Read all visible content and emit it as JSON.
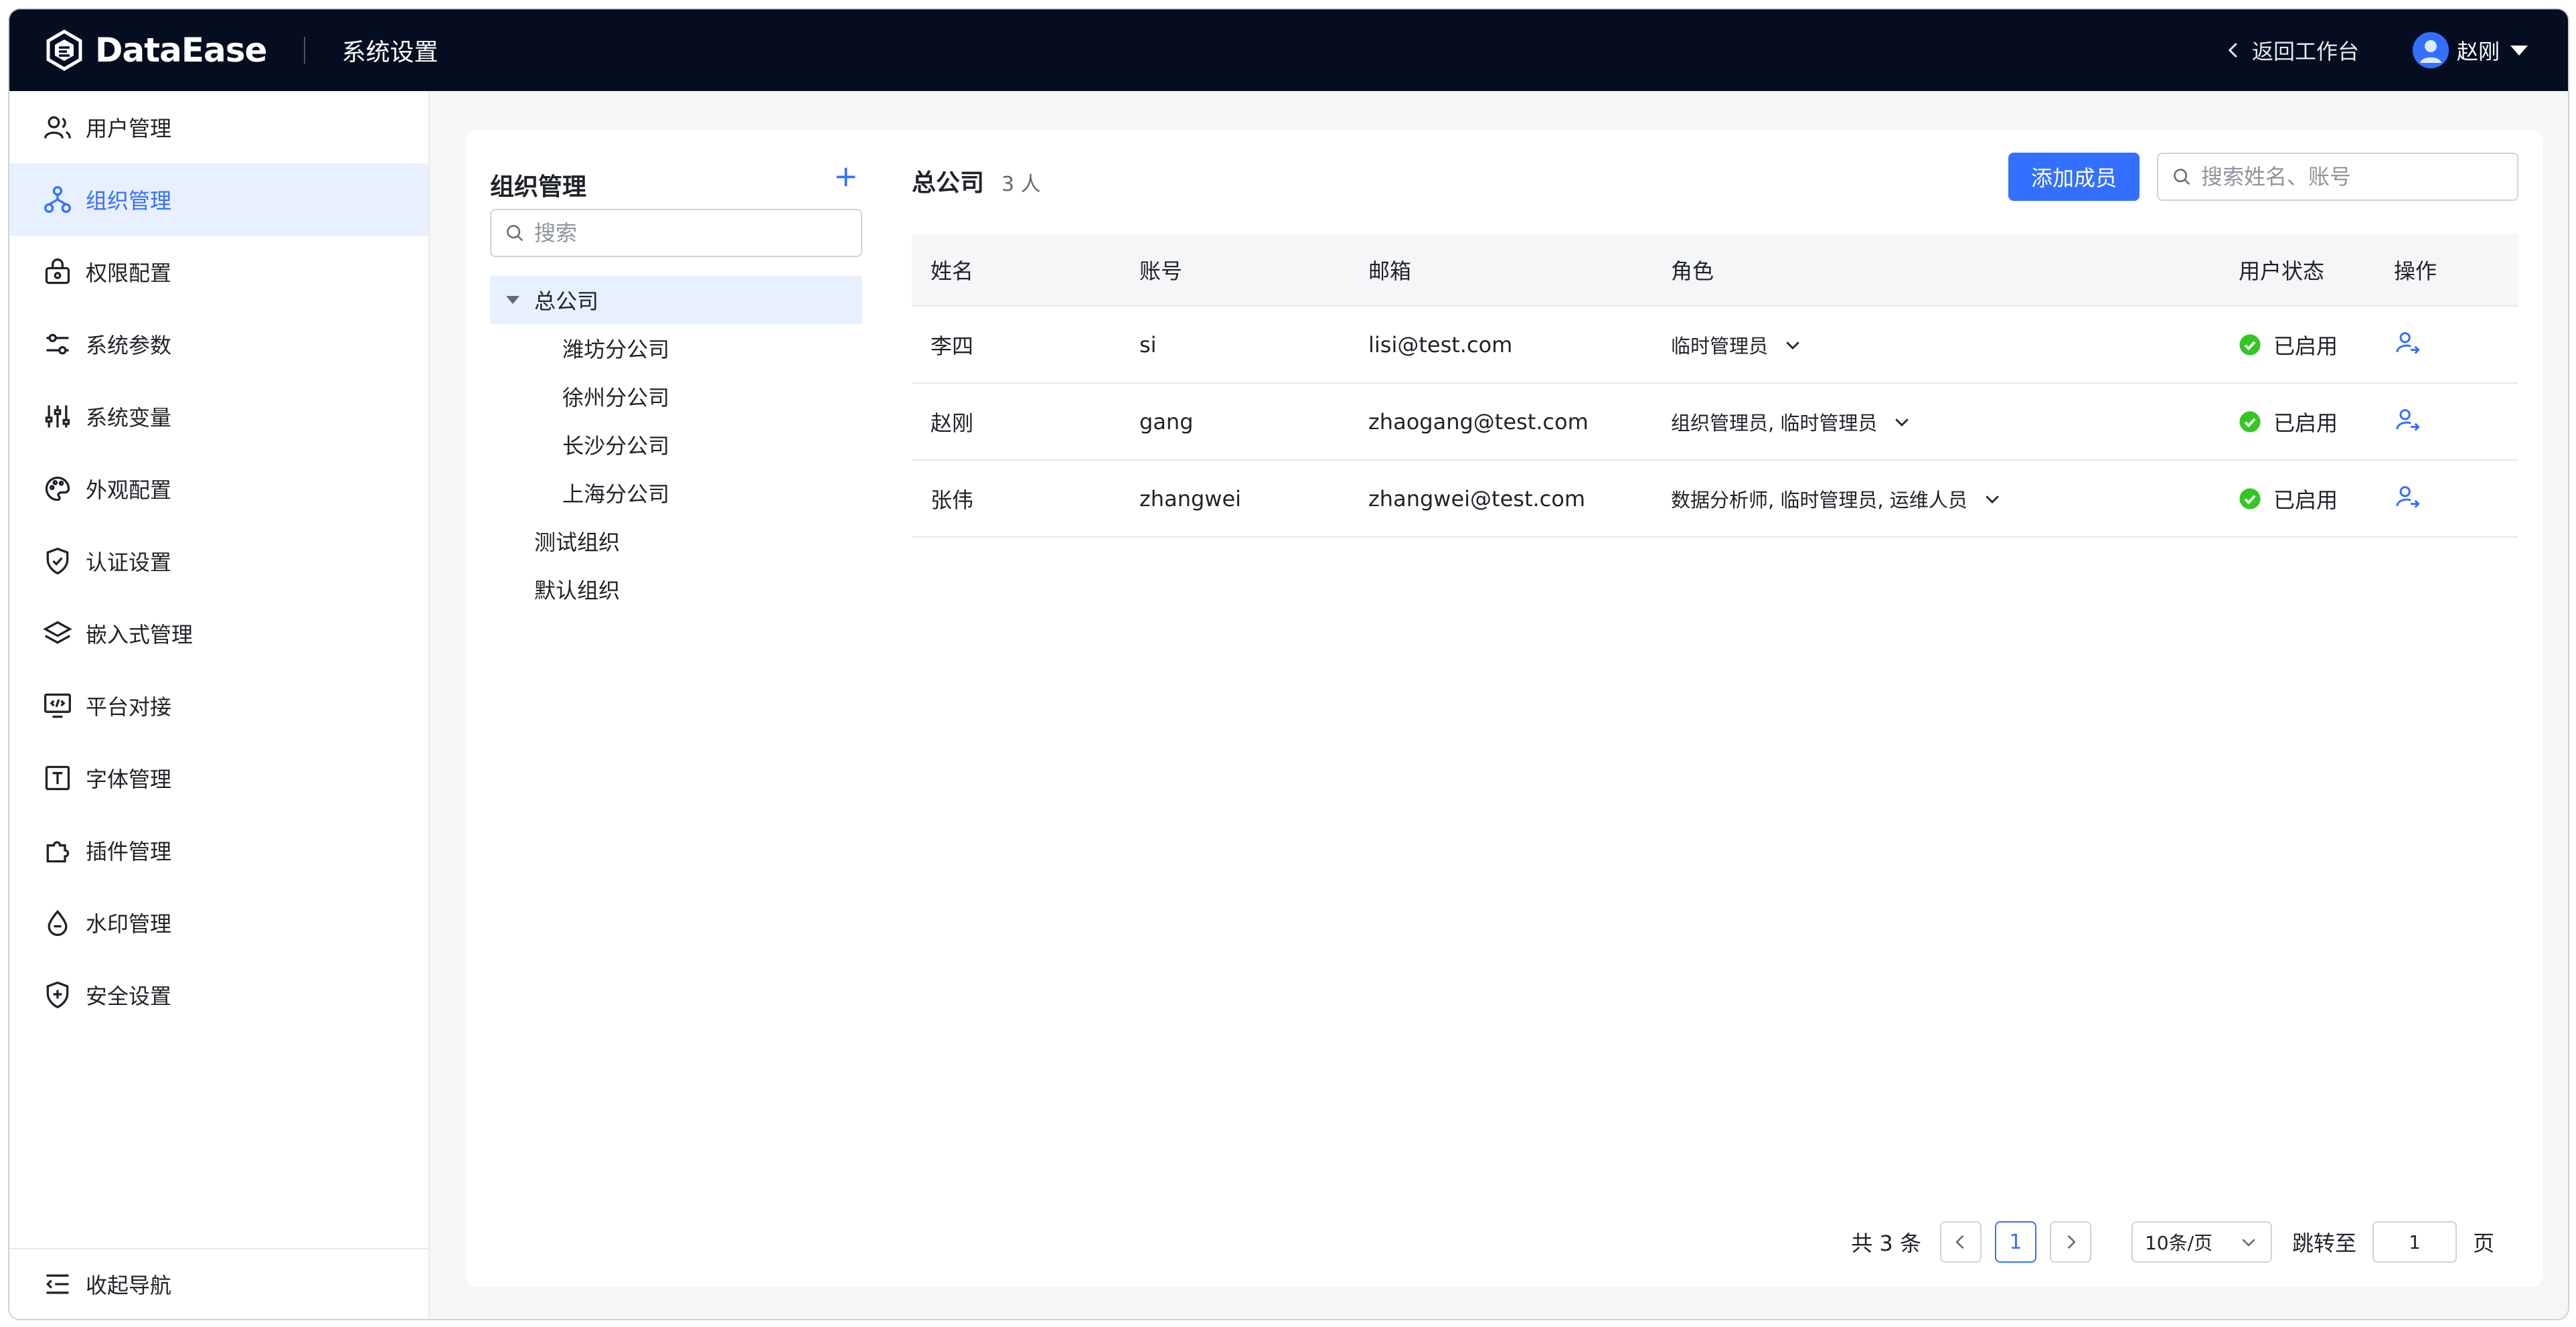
{
  "header": {
    "logo_text": "DataEase",
    "title": "系统设置",
    "back_label": "返回工作台",
    "user_name": "赵刚"
  },
  "sidebar": {
    "items": [
      {
        "label": "用户管理",
        "icon": "users-icon"
      },
      {
        "label": "组织管理",
        "icon": "org-icon",
        "active": true
      },
      {
        "label": "权限配置",
        "icon": "lock-icon"
      },
      {
        "label": "系统参数",
        "icon": "sliders-icon"
      },
      {
        "label": "系统变量",
        "icon": "variables-icon"
      },
      {
        "label": "外观配置",
        "icon": "palette-icon"
      },
      {
        "label": "认证设置",
        "icon": "shield-check-icon"
      },
      {
        "label": "嵌入式管理",
        "icon": "layers-icon"
      },
      {
        "label": "平台对接",
        "icon": "monitor-code-icon"
      },
      {
        "label": "字体管理",
        "icon": "font-icon"
      },
      {
        "label": "插件管理",
        "icon": "puzzle-icon"
      },
      {
        "label": "水印管理",
        "icon": "drop-icon"
      },
      {
        "label": "安全设置",
        "icon": "shield-plus-icon"
      }
    ],
    "collapse_label": "收起导航"
  },
  "org": {
    "title": "组织管理",
    "add_symbol": "+",
    "search_placeholder": "搜索",
    "root": "总公司",
    "children": [
      "潍坊分公司",
      "徐州分公司",
      "长沙分公司",
      "上海分公司"
    ],
    "others": [
      "测试组织",
      "默认组织"
    ]
  },
  "members": {
    "title": "总公司",
    "count": "3 人",
    "add_label": "添加成员",
    "search_placeholder": "搜索姓名、账号",
    "columns": [
      "姓名",
      "账号",
      "邮箱",
      "角色",
      "用户状态",
      "操作"
    ],
    "rows": [
      {
        "name": "李四",
        "account": "si",
        "email": "lisi@test.com",
        "roles": "临时管理员",
        "status": "已启用"
      },
      {
        "name": "赵刚",
        "account": "gang",
        "email": "zhaogang@test.com",
        "roles": "组织管理员, 临时管理员",
        "status": "已启用"
      },
      {
        "name": "张伟",
        "account": "zhangwei",
        "email": "zhangwei@test.com",
        "roles": "数据分析师, 临时管理员, 运维人员",
        "status": "已启用"
      }
    ]
  },
  "pager": {
    "total": "共 3 条",
    "current": "1",
    "page_size": "10条/页",
    "jump_label": "跳转至",
    "jump_value": "1",
    "page_unit": "页"
  },
  "colors": {
    "primary": "#3370ff",
    "header_bg": "#050e21",
    "success": "#34c724"
  }
}
